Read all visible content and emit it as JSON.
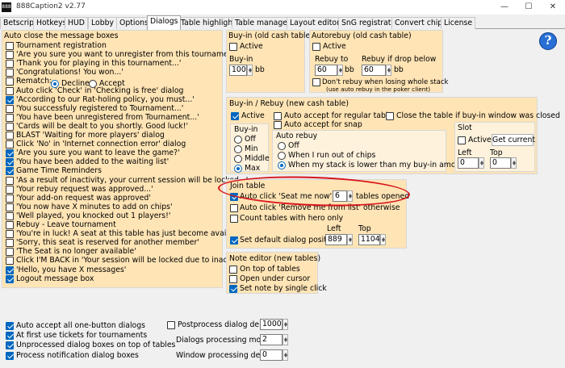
{
  "window": {
    "title": "888Caption2 v2.77",
    "app_icon": "app-icon",
    "minimize": "—",
    "maximize": "☐",
    "close": "✕"
  },
  "tabs": [
    "Betscript",
    "Hotkeys",
    "HUD",
    "Lobby",
    "Options",
    "Dialogs",
    "Table highlight",
    "Table manager",
    "Layout editor",
    "SnG registrator",
    "Convert chips",
    "License"
  ],
  "active_tab": "Dialogs",
  "auto_close": {
    "title": "Auto close the message boxes",
    "items": [
      {
        "label": "Tournament registration",
        "checked": false
      },
      {
        "label": "'Are you sure you want to unregister from this tournament?'",
        "checked": false
      },
      {
        "label": "'Thank you for playing in this tournament...'",
        "checked": false
      },
      {
        "label": "'Congratulations! You won...'",
        "checked": false
      },
      {
        "label": "Rematch:",
        "checked": false
      },
      {
        "label": "Auto click 'Check' in 'Checking is free' dialog",
        "checked": false
      },
      {
        "label": "'According to our Rat-holing policy, you must...'",
        "checked": true
      },
      {
        "label": "'You successfuly registered to Tournament...'",
        "checked": false
      },
      {
        "label": "'You have been unregistered from Tournament...'",
        "checked": false
      },
      {
        "label": "'Cards will be dealt to you shortly. Good luck!'",
        "checked": false
      },
      {
        "label": "BLAST 'Waiting for more players' dialog",
        "checked": false
      },
      {
        "label": "Click 'No' in 'Internet connection error' dialog",
        "checked": false
      },
      {
        "label": "'Are you sure you want to leave the game?'",
        "checked": true
      },
      {
        "label": "'You have been added to the waiting list'",
        "checked": true
      },
      {
        "label": "Game Time Reminders",
        "checked": true
      },
      {
        "label": "'As a result of inactivity, your current session will be locked...'",
        "checked": false
      },
      {
        "label": "'Your rebuy request was approved...'",
        "checked": false
      },
      {
        "label": "'Your add-on request was approved'",
        "checked": false
      },
      {
        "label": "'You now have X minutes to add on chips'",
        "checked": false
      },
      {
        "label": "'Well played, you knocked out 1 players!'",
        "checked": false
      },
      {
        "label": "Rebuy - Leave tournament",
        "checked": false
      },
      {
        "label": "'You're in luck! A seat at this table has just become available'",
        "checked": false
      },
      {
        "label": "'Sorry, this seat is reserved for another member'",
        "checked": false
      },
      {
        "label": "'The Seat is no longer available'",
        "checked": false
      },
      {
        "label": "Click I'M BACK in 'Your session will be locked due to inactivity'",
        "checked": false
      },
      {
        "label": "'Hello, you have X messages'",
        "checked": true
      },
      {
        "label": "Logout message box",
        "checked": true
      }
    ],
    "rematch_decline": "Decline",
    "rematch_accept": "Accept",
    "rematch_selected": "Decline"
  },
  "buyin_old": {
    "title": "Buy-in (old cash table)",
    "active": "Active",
    "buyin_label": "Buy-in",
    "buyin_value": "100",
    "unit": "bb"
  },
  "autorebuy_old": {
    "title": "Autorebuy (old cash table)",
    "active": "Active",
    "rebuy_to": "Rebuy to",
    "rebuy_to_value": "60",
    "rebuy_if_drop": "Rebuy if drop below",
    "rebuy_if_drop_value": "60",
    "unit": "bb",
    "dont_rebuy": "Don't rebuy when losing whole stack",
    "note": "(use auto rebuy in the poker client)"
  },
  "rebuy_new": {
    "title": "Buy-in / Rebuy (new cash table)",
    "active": "Active",
    "accept_regular": "Auto accept for regular table",
    "accept_snap": "Auto accept for snap",
    "close_table": "Close the table if buy-in window was closed",
    "buyin_group": "Buy-in",
    "buyin_options": [
      "Off",
      "Min",
      "Middle",
      "Max"
    ],
    "buyin_selected": "Max",
    "auto_rebuy_group": "Auto rebuy",
    "auto_rebuy_options": [
      "Off",
      "When I run out of chips",
      "When my stack is lower than my buy-in amount"
    ],
    "auto_rebuy_selected": "When my stack is lower than my buy-in amount",
    "slot_group": "Slot",
    "slot_active": "Active",
    "get_current": "Get current",
    "left": "Left",
    "top": "Top",
    "left_value": "0",
    "top_value": "0"
  },
  "join": {
    "title": "Join table",
    "auto_click_seat": "Auto click 'Seat me now' if <",
    "seat_value": "6",
    "tables_opened": "tables opened",
    "auto_click_remove": "Auto click 'Remove me from list' otherwise",
    "count_tables": "Count tables with hero only",
    "set_default_pos": "Set default dialog position",
    "left": "Left",
    "top": "Top",
    "left_value": "889",
    "top_value": "1104"
  },
  "note_editor": {
    "title": "Note editor (new tables)",
    "on_top": "On top of tables",
    "open_under": "Open under cursor",
    "set_note": "Set note by single click"
  },
  "bottom": {
    "auto_accept": "Auto accept all one-button dialogs",
    "first_use": "At first use tickets for tournaments",
    "unprocessed": "Unprocessed dialog boxes on top of tables",
    "process_notif": "Process notification dialog boxes",
    "postprocess": "Postprocess dialog delay",
    "postprocess_value": "1000",
    "dialogs_mode": "Dialogs processing mode",
    "dialogs_mode_value": "2",
    "window_delay": "Window processing delay",
    "window_delay_value": "0"
  },
  "help": "?"
}
